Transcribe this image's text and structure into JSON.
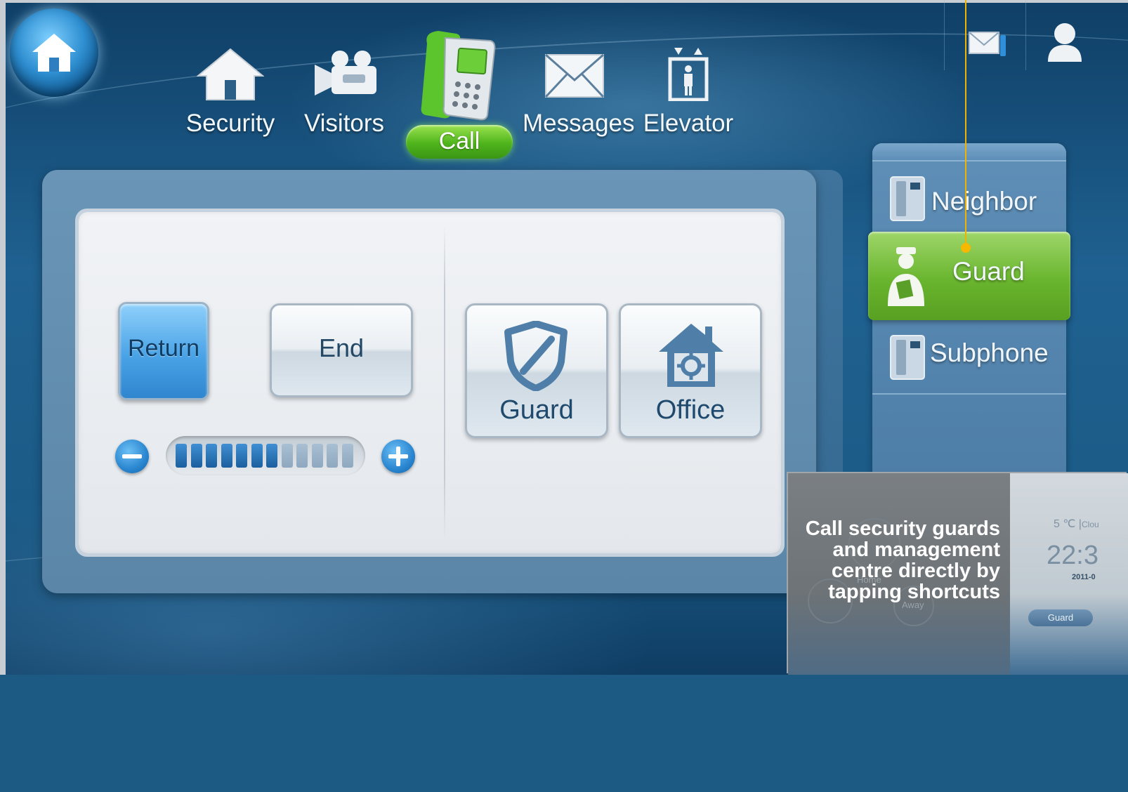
{
  "nav": {
    "items": [
      {
        "label": "Security",
        "icon": "house-icon"
      },
      {
        "label": "Visitors",
        "icon": "video-camera-icon"
      },
      {
        "label": "Call",
        "icon": "phone-icon",
        "active": true
      },
      {
        "label": "Messages",
        "icon": "envelope-icon"
      },
      {
        "label": "Elevator",
        "icon": "elevator-icon"
      }
    ]
  },
  "top_right": {
    "mail_icon": "mail-notification-icon",
    "user_icon": "user-icon"
  },
  "panel": {
    "return_label": "Return",
    "end_label": "End",
    "volume": {
      "level": 7,
      "max": 12
    },
    "shortcuts": [
      {
        "label": "Guard",
        "icon": "shield-icon"
      },
      {
        "label": "Office",
        "icon": "office-house-gear-icon"
      }
    ]
  },
  "side_menu": {
    "items": [
      {
        "label": "Neighbor",
        "icon": "intercom-icon"
      },
      {
        "label": "Guard",
        "icon": "guard-person-icon",
        "active": true
      },
      {
        "label": "Subphone",
        "icon": "intercom-icon"
      }
    ]
  },
  "callout": {
    "text": "Call security guards and management centre directly by tapping shortcuts"
  },
  "inset": {
    "temp": "5 ℃ |",
    "weather": "Clou",
    "time": "22:3",
    "date": "2011-0",
    "guard_button": "Guard",
    "home_label": "Home",
    "away_label": "Away"
  },
  "colors": {
    "accent_green": "#5fb426",
    "accent_blue": "#2f86cf",
    "callout_line": "#f0b400"
  }
}
